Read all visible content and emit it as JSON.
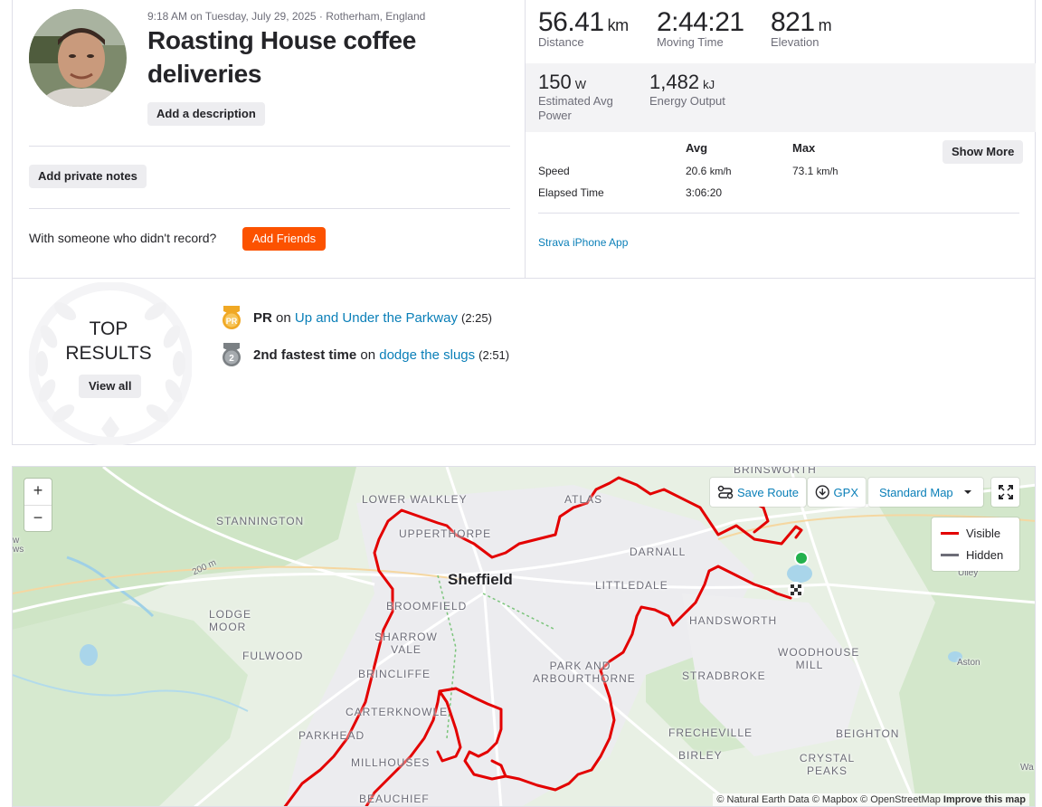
{
  "activity": {
    "meta": "9:18 AM on Tuesday, July 29, 2025 · Rotherham, England",
    "title": "Roasting House coffee deliveries",
    "add_description": "Add a description",
    "add_private_notes": "Add private notes",
    "with_someone": "With someone who didn't record?",
    "add_friends": "Add Friends"
  },
  "stats": {
    "distance": {
      "value": "56.41",
      "unit": "km",
      "label": "Distance"
    },
    "moving_time": {
      "value": "2:44:21",
      "label": "Moving Time"
    },
    "elevation": {
      "value": "821",
      "unit": "m",
      "label": "Elevation"
    },
    "power": {
      "value": "150",
      "unit": "W",
      "label": "Estimated Avg Power"
    },
    "energy": {
      "value": "1,482",
      "unit": "kJ",
      "label": "Energy Output"
    }
  },
  "more": {
    "col_avg": "Avg",
    "col_max": "Max",
    "speed_label": "Speed",
    "speed_avg": "20.6",
    "speed_max": "73.1",
    "speed_unit": "km/h",
    "elapsed_label": "Elapsed Time",
    "elapsed_avg": "3:06:20",
    "show_more": "Show More",
    "device": "Strava iPhone App"
  },
  "results": {
    "title": "TOP RESULTS",
    "view_all": "View all",
    "items": [
      {
        "badge": "PR",
        "rank_text": "PR",
        "on": "on",
        "segment": "Up and Under the Parkway",
        "time": "(2:25)",
        "color": "#f0a824"
      },
      {
        "badge": "2",
        "rank_text": "2nd fastest time",
        "on": "on",
        "segment": "dodge the slugs",
        "time": "(2:51)",
        "color": "#7b8084"
      }
    ]
  },
  "map": {
    "zoom_in": "+",
    "zoom_out": "−",
    "save_route": "Save Route",
    "gpx": "GPX",
    "map_style": "Standard Map",
    "legend_visible": "Visible",
    "legend_hidden": "Hidden",
    "route_color": "#e30000",
    "hidden_color": "#6d6d78",
    "attribution_text": "© Natural Earth Data © Mapbox © OpenStreetMap",
    "attribution_link": "Improve this map",
    "labels": {
      "brinsworth": "BRINSWORTH",
      "lower_walkley": "LOWER WALKLEY",
      "atlas": "ATLAS",
      "stannington": "STANNINGTON",
      "upperthorpe": "UPPERTHORPE",
      "darnall": "DARNALL",
      "sheffield": "Sheffield",
      "littledale": "LITTLEDALE",
      "lodge_moor": "LODGE MOOR",
      "broomfield": "BROOMFIELD",
      "handsworth": "HANDSWORTH",
      "fulwood": "FULWOOD",
      "sharrow_vale": "SHARROW VALE",
      "park_and_arbourthorne": "PARK AND ARBOURTHORNE",
      "woodhouse_mill": "WOODHOUSE MILL",
      "brincliffe": "BRINCLIFFE",
      "stradbroke": "STRADBROKE",
      "carterknowle": "CARTERKNOWLE",
      "frecheville": "FRECHEVILLE",
      "beighton": "BEIGHTON",
      "parkhead": "PARKHEAD",
      "birley": "BIRLEY",
      "crystal_peaks": "CRYSTAL PEAKS",
      "millhouses": "MILLHOUSES",
      "beauchief": "BEAUCHIEF",
      "ulley": "Ulley",
      "aston": "Aston",
      "elev": "200 m",
      "wa": "Wa",
      "ws": "ws",
      "w": "w"
    }
  }
}
